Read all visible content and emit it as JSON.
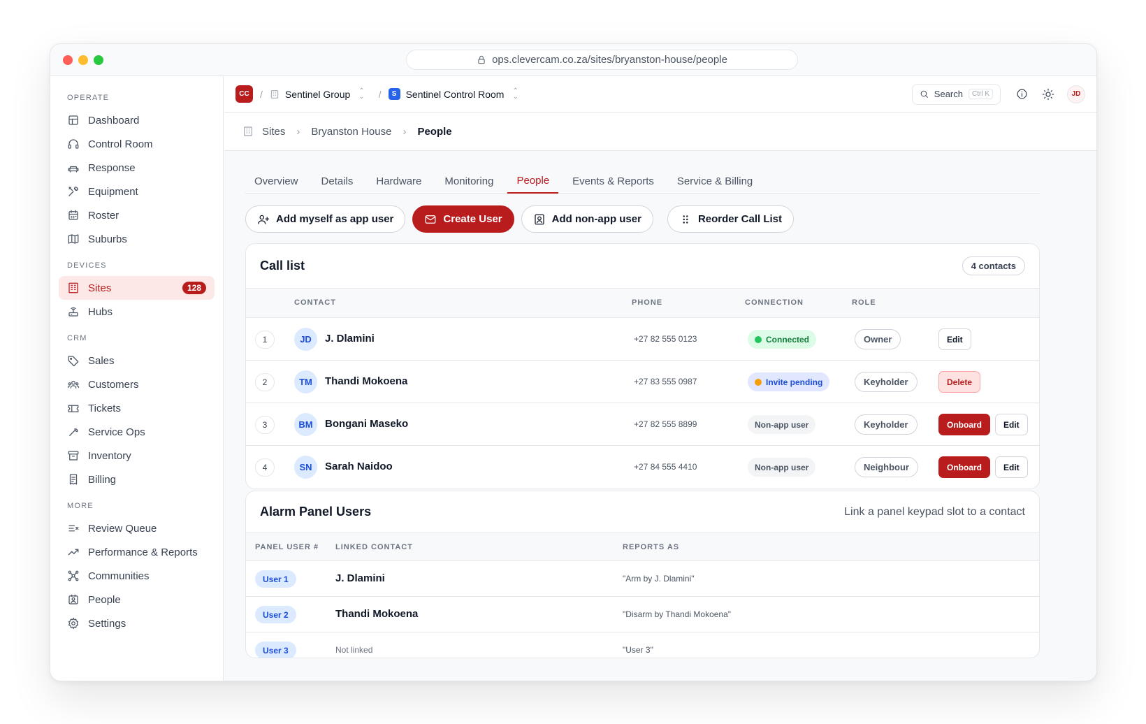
{
  "browser": {
    "url": "ops.clevercam.co.za/sites/bryanston-house/people"
  },
  "sidebar": {
    "sections": [
      {
        "title": "OPERATE",
        "items": [
          {
            "label": "Dashboard",
            "icon": "dashboard-icon"
          },
          {
            "label": "Control Room",
            "icon": "headset-icon"
          },
          {
            "label": "Response",
            "icon": "car-icon"
          },
          {
            "label": "Equipment",
            "icon": "tools-icon"
          },
          {
            "label": "Roster",
            "icon": "calendar-icon"
          },
          {
            "label": "Suburbs",
            "icon": "map-icon"
          }
        ]
      },
      {
        "title": "DEVICES",
        "items": [
          {
            "label": "Sites",
            "icon": "building-icon",
            "badge": "128",
            "active": true
          },
          {
            "label": "Hubs",
            "icon": "router-icon"
          }
        ]
      },
      {
        "title": "CRM",
        "items": [
          {
            "label": "Sales",
            "icon": "tag-icon"
          },
          {
            "label": "Customers",
            "icon": "users-icon"
          },
          {
            "label": "Tickets",
            "icon": "ticket-icon"
          },
          {
            "label": "Service Ops",
            "icon": "wrench-icon"
          },
          {
            "label": "Inventory",
            "icon": "archive-icon"
          },
          {
            "label": "Billing",
            "icon": "receipt-icon"
          }
        ]
      },
      {
        "title": "MORE",
        "items": [
          {
            "label": "Review Queue",
            "icon": "list-x-icon"
          },
          {
            "label": "Performance & Reports",
            "icon": "trend-icon"
          },
          {
            "label": "Communities",
            "icon": "network-icon"
          },
          {
            "label": "People",
            "icon": "contact-icon"
          },
          {
            "label": "Settings",
            "icon": "gear-icon"
          }
        ]
      }
    ]
  },
  "topbar": {
    "logo": "CC",
    "org": "Sentinel Group",
    "workspace_initial": "S",
    "workspace": "Sentinel Control Room",
    "search_label": "Search",
    "search_shortcut": "Ctrl K",
    "user_initials": "JD"
  },
  "breadcrumb": {
    "root": "Sites",
    "site": "Bryanston House",
    "current": "People"
  },
  "tabs": [
    {
      "label": "Overview"
    },
    {
      "label": "Details"
    },
    {
      "label": "Hardware"
    },
    {
      "label": "Monitoring"
    },
    {
      "label": "People",
      "active": true
    },
    {
      "label": "Events & Reports"
    },
    {
      "label": "Service & Billing"
    }
  ],
  "actions": {
    "add_myself": "Add myself as app user",
    "create_user": "Create User",
    "add_non_app": "Add non-app user",
    "reorder": "Reorder Call List"
  },
  "call_list": {
    "title": "Call list",
    "count": "4 contacts",
    "columns": {
      "contact": "CONTACT",
      "phone": "PHONE",
      "connection": "CONNECTION",
      "role": "ROLE"
    },
    "rows": [
      {
        "num": "1",
        "initials": "JD",
        "name": "J. Dlamini",
        "phone": "+27 82 555 0123",
        "connection": "Connected",
        "conn_type": "ok",
        "role": "Owner",
        "buttons": [
          {
            "label": "Edit",
            "style": "plain"
          }
        ]
      },
      {
        "num": "2",
        "initials": "TM",
        "name": "Thandi Mokoena",
        "phone": "+27 83 555 0987",
        "connection": "Invite pending",
        "conn_type": "wait",
        "role": "Keyholder",
        "buttons": [
          {
            "label": "Delete",
            "style": "del"
          }
        ]
      },
      {
        "num": "3",
        "initials": "BM",
        "name": "Bongani Maseko",
        "phone": "+27 82 555 8899",
        "connection": "Non-app user",
        "conn_type": "non",
        "role": "Keyholder",
        "buttons": [
          {
            "label": "Onboard",
            "style": "red"
          },
          {
            "label": "Edit",
            "style": "plain"
          }
        ]
      },
      {
        "num": "4",
        "initials": "SN",
        "name": "Sarah Naidoo",
        "phone": "+27 84 555 4410",
        "connection": "Non-app user",
        "conn_type": "non",
        "role": "Neighbour",
        "buttons": [
          {
            "label": "Onboard",
            "style": "red"
          },
          {
            "label": "Edit",
            "style": "plain"
          }
        ]
      }
    ]
  },
  "panel_users": {
    "title": "Alarm Panel Users",
    "hint": "Link a panel keypad slot to a contact",
    "columns": {
      "user": "PANEL USER #",
      "contact": "LINKED CONTACT",
      "reports": "REPORTS AS"
    },
    "rows": [
      {
        "user": "User 1",
        "contact": "J. Dlamini",
        "linked": true,
        "reports": "\"Arm by J. Dlamini\""
      },
      {
        "user": "User 2",
        "contact": "Thandi Mokoena",
        "linked": true,
        "reports": "\"Disarm by Thandi Mokoena\""
      },
      {
        "user": "User 3",
        "contact": "Not linked",
        "linked": false,
        "reports": "\"User 3\""
      }
    ]
  },
  "colors": {
    "accent": "#b91c1c",
    "connected": "#22c55e",
    "pending": "#f59e0b"
  }
}
